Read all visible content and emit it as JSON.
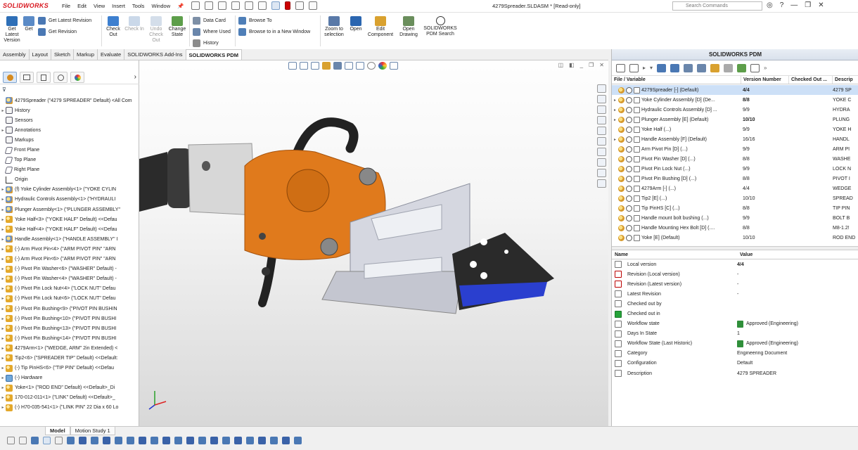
{
  "app": {
    "brand": "SOLIDWORKS",
    "document_title": "4279Spreader.SLDASM * [Read-only]"
  },
  "menu": [
    "File",
    "Edit",
    "View",
    "Insert",
    "Tools",
    "Window"
  ],
  "search": {
    "placeholder": "Search Commands"
  },
  "window_controls": {
    "help": "?",
    "minimize": "—",
    "restore": "❐",
    "close": "✕"
  },
  "ribbon": {
    "get_latest": "Get Latest Version",
    "get": "Get",
    "get_latest_revision": "Get Latest Revision",
    "get_revision": "Get Revision",
    "check_out": "Check Out",
    "check_in": "Check In",
    "undo_check_out": "Undo Check Out",
    "change_state": "Change State",
    "data_card": "Data Card",
    "where_used": "Where Used",
    "history": "History",
    "browse_to": "Browse To",
    "browse_to_new_window": "Browse to in a New Window",
    "zoom_to_selection": "Zoom to selection",
    "open": "Open",
    "edit_component": "Edit Component",
    "open_drawing": "Open Drawing",
    "pdm_search": "SOLIDWORKS PDM Search"
  },
  "command_tabs": [
    "Assembly",
    "Layout",
    "Sketch",
    "Markup",
    "Evaluate",
    "SOLIDWORKS Add-Ins",
    "SOLIDWORKS PDM"
  ],
  "active_tab": "SOLIDWORKS PDM",
  "feature_tree": {
    "items": [
      {
        "icon": "assembly",
        "label": "4279Spreader (\"4279 SPREADER\" Default) <All Com",
        "twisty": ""
      },
      {
        "icon": "history",
        "label": "History",
        "twisty": "▸"
      },
      {
        "icon": "sensor",
        "label": "Sensors",
        "twisty": ""
      },
      {
        "icon": "annot",
        "label": "Annotations",
        "twisty": "▸"
      },
      {
        "icon": "markup",
        "label": "Markups",
        "twisty": ""
      },
      {
        "icon": "plane",
        "label": "Front Plane",
        "twisty": ""
      },
      {
        "icon": "plane",
        "label": "Top Plane",
        "twisty": ""
      },
      {
        "icon": "plane",
        "label": "Right Plane",
        "twisty": ""
      },
      {
        "icon": "origin",
        "label": "Origin",
        "twisty": ""
      },
      {
        "icon": "assembly",
        "label": "(f) Yoke Cylinder Assembly<1> (\"YOKE CYLIN",
        "twisty": "▸"
      },
      {
        "icon": "assembly",
        "label": "Hydraulic Controls Assembly<1> (\"HYDRAULI",
        "twisty": "▸"
      },
      {
        "icon": "assembly",
        "label": "Plunger Assembly<1> (\"PLUNGER ASSEMBLY\"",
        "twisty": "▸"
      },
      {
        "icon": "part",
        "label": "Yoke Half<3> (\"YOKE HALF\" Default) <<Defau",
        "twisty": "▸"
      },
      {
        "icon": "part",
        "label": "Yoke Half<4> (\"YOKE HALF\" Default) <<Defau",
        "twisty": "▸"
      },
      {
        "icon": "assembly",
        "label": "Handle Assembly<1> (\"HANDLE ASSEMBLY\" I",
        "twisty": "▸"
      },
      {
        "icon": "part",
        "label": "(-) Arm Pivot Pin<4> (\"ARM PIVOT PIN\" \"ARN",
        "twisty": "▸"
      },
      {
        "icon": "part",
        "label": "(-) Arm Pivot Pin<6> (\"ARM PIVOT PIN\" \"ARN",
        "twisty": "▸"
      },
      {
        "icon": "part",
        "label": "(-) Pivot Pin Washer<6> (\"WASHER\" Default) -",
        "twisty": "▸"
      },
      {
        "icon": "part",
        "label": "(-) Pivot Pin Washer<4> (\"WASHER\" Default) -",
        "twisty": "▸"
      },
      {
        "icon": "part",
        "label": "(-) Pivot Pin Lock Nut<4> (\"LOCK NUT\" Defau",
        "twisty": "▸"
      },
      {
        "icon": "part",
        "label": "(-) Pivot Pin Lock Nut<6> (\"LOCK NUT\" Defau",
        "twisty": "▸"
      },
      {
        "icon": "part",
        "label": "(-) Pivot Pin Bushing<9> (\"PIVOT PIN BUSHIN",
        "twisty": "▸"
      },
      {
        "icon": "part",
        "label": "(-) Pivot Pin Bushing<10> (\"PIVOT PIN BUSHI",
        "twisty": "▸"
      },
      {
        "icon": "part",
        "label": "(-) Pivot Pin Bushing<13> (\"PIVOT PIN BUSHI",
        "twisty": "▸"
      },
      {
        "icon": "part",
        "label": "(-) Pivot Pin Bushing<14> (\"PIVOT PIN BUSHI",
        "twisty": "▸"
      },
      {
        "icon": "part",
        "label": "4279Arm<1> (\"WEDGE, ARM\" 2in Extended) <",
        "twisty": "▸"
      },
      {
        "icon": "part",
        "label": "Tip2<6> (\"SPREADER TIP\" Default) <<Default:",
        "twisty": "▸"
      },
      {
        "icon": "part",
        "label": "(-) Tip PinHS<6> (\"TIP PIN\" Default) <<Defau",
        "twisty": "▸"
      },
      {
        "icon": "folder",
        "label": "(-) Hardware",
        "twisty": "▸"
      },
      {
        "icon": "part",
        "label": "Yoke<1> (\"ROD END\" Default) <<Default>_Di",
        "twisty": "▸"
      },
      {
        "icon": "part",
        "label": "170-012-011<1> (\"LINK\" Default) <<Default>_",
        "twisty": "▸"
      },
      {
        "icon": "part",
        "label": "(-) H70-035-541<1> (\"LINK PIN\" 22 Dia x 60 Lo",
        "twisty": "▸"
      }
    ]
  },
  "pdm_panel": {
    "title": "SOLIDWORKS PDM",
    "columns": [
      "File / Variable",
      "Version Number",
      "Checked Out ...",
      "Descrip"
    ],
    "rows": [
      {
        "twisty": "",
        "name": "4279Spreader  [-]  (Default)",
        "version": "4/4",
        "checked": "",
        "desc": "4279 SP",
        "bold": true,
        "selected": true
      },
      {
        "twisty": "▸",
        "name": "Yoke Cylinder Assembly  [D]  (De...",
        "version": "8/8",
        "checked": "",
        "desc": "YOKE C",
        "bold": true,
        "selected": false
      },
      {
        "twisty": "▸",
        "name": "Hydraulic Controls Assembly  [D] ...",
        "version": "9/9",
        "checked": "",
        "desc": "HYDRA",
        "bold": false,
        "selected": false
      },
      {
        "twisty": "▸",
        "name": "Plunger Assembly  [E]  (Default)",
        "version": "10/10",
        "checked": "",
        "desc": "PLUNG",
        "bold": true,
        "selected": false
      },
      {
        "twisty": "",
        "name": "Yoke Half  (...)",
        "version": "9/9",
        "checked": "",
        "desc": "YOKE H",
        "bold": false,
        "selected": false
      },
      {
        "twisty": "▸",
        "name": "Handle Assembly  [F]  (Default)",
        "version": "16/16",
        "checked": "",
        "desc": "HANDL",
        "bold": false,
        "selected": false
      },
      {
        "twisty": "",
        "name": "Arm Pivot Pin  [D]  (...)",
        "version": "9/9",
        "checked": "",
        "desc": "ARM PI",
        "bold": false,
        "selected": false
      },
      {
        "twisty": "",
        "name": "Pivot Pin Washer  [D]  (...)",
        "version": "8/8",
        "checked": "",
        "desc": "WASHE",
        "bold": false,
        "selected": false
      },
      {
        "twisty": "",
        "name": "Pivot Pin Lock Nut  (...)",
        "version": "9/9",
        "checked": "",
        "desc": "LOCK N",
        "bold": false,
        "selected": false
      },
      {
        "twisty": "",
        "name": "Pivot Pin Bushing  [D]  (...)",
        "version": "8/8",
        "checked": "",
        "desc": "PIVOT I",
        "bold": false,
        "selected": false
      },
      {
        "twisty": "",
        "name": "4279Arm  [-]  (...)",
        "version": "4/4",
        "checked": "",
        "desc": "WEDGE",
        "bold": false,
        "selected": false
      },
      {
        "twisty": "",
        "name": "Tip2  [E]  (...)",
        "version": "10/10",
        "checked": "",
        "desc": "SPREAD",
        "bold": false,
        "selected": false
      },
      {
        "twisty": "",
        "name": "Tip PinHS  [C]  (...)",
        "version": "8/8",
        "checked": "",
        "desc": "TIP PIN",
        "bold": false,
        "selected": false
      },
      {
        "twisty": "",
        "name": "Handle mount bolt bushing  (...)",
        "version": "9/9",
        "checked": "",
        "desc": "BOLT B",
        "bold": false,
        "selected": false
      },
      {
        "twisty": "",
        "name": "Handle Mounting Hex Bolt  [D]  (....",
        "version": "8/8",
        "checked": "",
        "desc": "M8-1.2!",
        "bold": false,
        "selected": false
      },
      {
        "twisty": "",
        "name": "Yoke  [E]  (Default)",
        "version": "10/10",
        "checked": "",
        "desc": "ROD END",
        "bold": false,
        "selected": false
      }
    ]
  },
  "properties": {
    "headers": [
      "Name",
      "Value"
    ],
    "rows": [
      {
        "icon": "ver",
        "name": "Local version",
        "value": "4/4",
        "bold": true,
        "badge": false
      },
      {
        "icon": "chk",
        "name": "Revision (Local version)",
        "value": "-",
        "bold": false,
        "badge": false
      },
      {
        "icon": "chk",
        "name": "Revision (Latest version)",
        "value": "-",
        "bold": false,
        "badge": false
      },
      {
        "icon": "ver",
        "name": "Latest Revision",
        "value": "-",
        "bold": false,
        "badge": false
      },
      {
        "icon": "ver",
        "name": "Checked out by",
        "value": "",
        "bold": false,
        "badge": false
      },
      {
        "icon": "green",
        "name": "Checked out in",
        "value": "",
        "bold": false,
        "badge": false
      },
      {
        "icon": "ver",
        "name": "Workflow state",
        "value": "Approved (Engineering)",
        "bold": false,
        "badge": true
      },
      {
        "icon": "ver",
        "name": "Days In State",
        "value": "1",
        "bold": false,
        "badge": false
      },
      {
        "icon": "ver",
        "name": "Workflow State (Last Historic)",
        "value": "Approved (Engineering)",
        "bold": false,
        "badge": true
      },
      {
        "icon": "ver",
        "name": "Category",
        "value": "Engineering Document",
        "bold": false,
        "badge": false
      },
      {
        "icon": "ver",
        "name": "Configuration",
        "value": "Default",
        "bold": false,
        "badge": false
      },
      {
        "icon": "ver",
        "name": "Description",
        "value": "4279 SPREADER",
        "bold": false,
        "badge": false
      }
    ]
  },
  "bottom_tabs": [
    "Model",
    "Motion Study 1"
  ],
  "colors": {
    "accent": "#e07a1c",
    "selection": "#cde0f7",
    "brand_red": "#d8161e"
  }
}
